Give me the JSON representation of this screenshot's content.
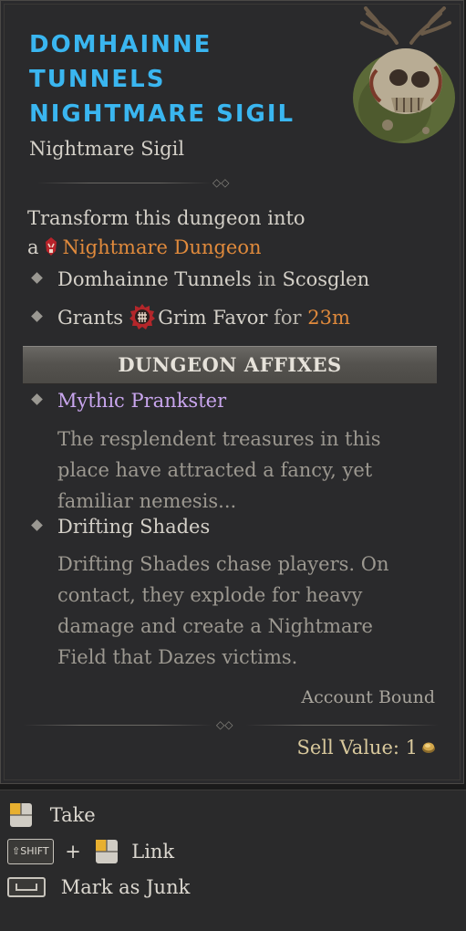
{
  "item": {
    "name": "Domhainne Tunnels Nightmare Sigil",
    "type": "Nightmare Sigil"
  },
  "description": {
    "line1": "Transform this dungeon into",
    "prefix": "a",
    "dungeon_type": "Nightmare Dungeon"
  },
  "details": {
    "location_dungeon": "Domhainne Tunnels",
    "location_in": "in",
    "location_region": "Scosglen",
    "grants_label": "Grants",
    "grants_item": "Grim Favor",
    "grants_for": "for",
    "grants_duration": "23m"
  },
  "affixes": {
    "header": "DUNGEON AFFIXES",
    "list": [
      {
        "name": "Mythic Prankster",
        "description": "The resplendent treasures in this place have attracted a fancy, yet familiar nemesis..."
      },
      {
        "name": "Drifting Shades",
        "description": "Drifting Shades chase players. On contact, they explode for heavy damage and create a Nightmare Field that Dazes victims."
      }
    ]
  },
  "footer": {
    "account_bound": "Account Bound",
    "sell_value_label": "Sell Value: 1"
  },
  "controls": {
    "take": "Take",
    "shift_key": "SHIFT",
    "plus": "+",
    "link": "Link",
    "mark_junk": "Mark as Junk"
  },
  "icons": {
    "sigil": "nightmare-sigil-icon",
    "nightmare": "nightmare-dungeon-icon",
    "grim_favor": "grim-favor-icon",
    "gold": "gold-icon",
    "mouse_left": "left-mouse-icon",
    "shift": "shift-key-icon",
    "space": "spacebar-key-icon"
  },
  "colors": {
    "item_name": "#3ab6f0",
    "orange_highlight": "#e08a3c",
    "mythic_purple": "#c9a6ee",
    "sell_value": "#d8c89c"
  }
}
